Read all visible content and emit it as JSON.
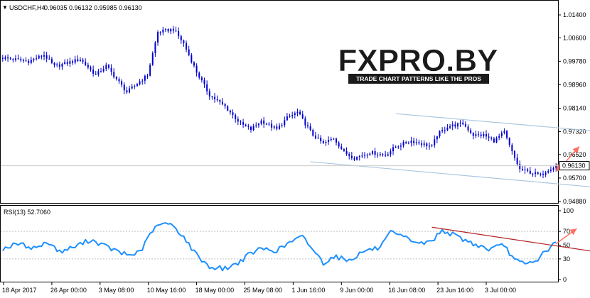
{
  "header": {
    "symbol": "USDCHF,H4",
    "quotes": "0.96035 0.96132 0.95985 0.96130",
    "indicator": "RSI(13) 52.7060"
  },
  "watermark": {
    "logo_text": "FXPRO.BY",
    "tagline": "TRADE CHART PATTERNS LIKE THE PROS"
  },
  "colors": {
    "candle": "#0000cd",
    "rsi_line": "#1e90ff",
    "channel": "#a9c6df",
    "rsi_trend": "#b22222",
    "arrow": "#ff6f61",
    "current_price_bg": "#ffffff"
  },
  "chart_data": [
    {
      "type": "line",
      "series_kind": "candlestick",
      "current_price": "0.96130",
      "ylim": [
        0.9488,
        1.014
      ],
      "price_ticks": [
        "1.01400",
        "1.00600",
        "0.99780",
        "0.98960",
        "0.98140",
        "0.97320",
        "0.96520",
        "0.95700",
        "0.94880"
      ],
      "x_ticks": [
        "18 Apr 2017",
        "26 Apr 00:00",
        "3 May 08:00",
        "10 May 16:00",
        "18 May 00:00",
        "25 May 08:00",
        "1 Jun 16:00",
        "9 Jun 00:00",
        "16 Jun 08:00",
        "23 Jun 16:00",
        "3 Jul 00:00"
      ],
      "anchors": [
        [
          0,
          0.999
        ],
        [
          10,
          0.9978
        ],
        [
          16,
          1.0
        ],
        [
          20,
          0.996
        ],
        [
          30,
          0.9985
        ],
        [
          36,
          0.993
        ],
        [
          40,
          0.9962
        ],
        [
          48,
          0.987
        ],
        [
          52,
          0.99
        ],
        [
          56,
          0.993
        ],
        [
          60,
          1.008
        ],
        [
          66,
          1.009
        ],
        [
          70,
          1.004
        ],
        [
          75,
          0.994
        ],
        [
          80,
          0.986
        ],
        [
          86,
          0.982
        ],
        [
          92,
          0.976
        ],
        [
          96,
          0.974
        ],
        [
          100,
          0.977
        ],
        [
          106,
          0.974
        ],
        [
          110,
          0.978
        ],
        [
          114,
          0.98
        ],
        [
          120,
          0.972
        ],
        [
          124,
          0.969
        ],
        [
          128,
          0.971
        ],
        [
          132,
          0.966
        ],
        [
          136,
          0.964
        ],
        [
          142,
          0.966
        ],
        [
          148,
          0.965
        ],
        [
          152,
          0.968
        ],
        [
          158,
          0.97
        ],
        [
          162,
          0.969
        ],
        [
          166,
          0.968
        ],
        [
          168,
          0.972
        ],
        [
          172,
          0.975
        ],
        [
          178,
          0.976
        ],
        [
          182,
          0.972
        ],
        [
          186,
          0.972
        ],
        [
          190,
          0.97
        ],
        [
          194,
          0.973
        ],
        [
          197,
          0.966
        ],
        [
          200,
          0.96
        ],
        [
          204,
          0.959
        ],
        [
          208,
          0.958
        ],
        [
          211,
          0.96
        ],
        [
          214,
          0.9613
        ]
      ],
      "lines": [
        {
          "name": "",
          "from": [
            152,
            0.9795
          ],
          "to": [
            272,
            0.97
          ]
        },
        {
          "name": "",
          "from": [
            119,
            0.9627
          ],
          "to": [
            239,
            0.953
          ]
        }
      ],
      "arrows": [
        {
          "from": [
            214,
            0.96
          ],
          "to": [
            223,
            0.968
          ]
        }
      ]
    },
    {
      "type": "line",
      "series_kind": "indicator",
      "ylim": [
        0,
        100
      ],
      "ticks": [
        "100",
        "70",
        "50",
        "30",
        "0"
      ],
      "anchors": [
        [
          0,
          45
        ],
        [
          6,
          52
        ],
        [
          12,
          46
        ],
        [
          18,
          54
        ],
        [
          22,
          40
        ],
        [
          28,
          48
        ],
        [
          34,
          58
        ],
        [
          40,
          48
        ],
        [
          46,
          38
        ],
        [
          50,
          35
        ],
        [
          54,
          45
        ],
        [
          58,
          72
        ],
        [
          62,
          82
        ],
        [
          66,
          78
        ],
        [
          70,
          62
        ],
        [
          74,
          40
        ],
        [
          80,
          18
        ],
        [
          86,
          16
        ],
        [
          90,
          22
        ],
        [
          96,
          38
        ],
        [
          100,
          45
        ],
        [
          106,
          42
        ],
        [
          112,
          56
        ],
        [
          116,
          62
        ],
        [
          120,
          44
        ],
        [
          124,
          24
        ],
        [
          128,
          34
        ],
        [
          134,
          28
        ],
        [
          140,
          42
        ],
        [
          146,
          46
        ],
        [
          150,
          68
        ],
        [
          156,
          60
        ],
        [
          162,
          52
        ],
        [
          166,
          56
        ],
        [
          170,
          72
        ],
        [
          176,
          62
        ],
        [
          182,
          52
        ],
        [
          188,
          44
        ],
        [
          194,
          50
        ],
        [
          198,
          28
        ],
        [
          202,
          22
        ],
        [
          206,
          26
        ],
        [
          210,
          42
        ],
        [
          214,
          52.7
        ]
      ],
      "lines": [
        {
          "name": "",
          "from": [
            166,
            76
          ],
          "to": [
            230,
            40
          ]
        }
      ],
      "arrows": [
        {
          "from": [
            214,
            52
          ],
          "to": [
            222,
            74
          ]
        }
      ]
    }
  ]
}
